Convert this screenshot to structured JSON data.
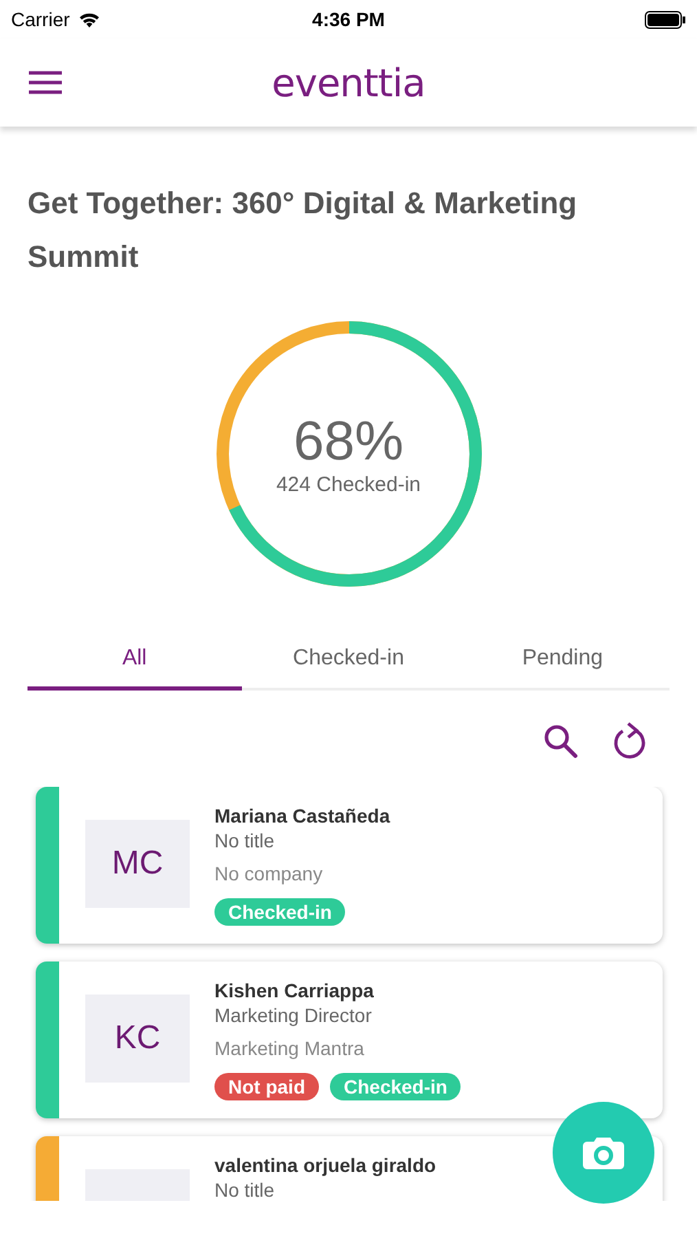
{
  "status_bar": {
    "carrier": "Carrier",
    "time": "4:36 PM"
  },
  "header": {
    "logo": "eventtia"
  },
  "event": {
    "title": "Get Together: 360° Digital & Marketing Summit"
  },
  "progress": {
    "percent": "68%",
    "caption": "424 Checked-in",
    "level": 0.68
  },
  "tabs": [
    {
      "label": "All",
      "selected": true
    },
    {
      "label": "Checked-in",
      "selected": false
    },
    {
      "label": "Pending",
      "selected": false
    }
  ],
  "attendees": [
    {
      "initials": "MC",
      "name": "Mariana Castañeda",
      "title": "No title",
      "company": "No company",
      "color": "#2ecb98",
      "tags": [
        {
          "kind": "checked_in",
          "label": "Checked-in"
        }
      ]
    },
    {
      "initials": "KC",
      "name": "Kishen Carriappa",
      "title": "Marketing Director",
      "company": "Marketing Mantra",
      "color": "#2ecb98",
      "tags": [
        {
          "kind": "not_paid",
          "label": "Not paid"
        },
        {
          "kind": "checked_in",
          "label": "Checked-in"
        }
      ]
    },
    {
      "name": "valentina orjuela giraldo",
      "title": "No title",
      "color": "#f5ab35"
    }
  ]
}
